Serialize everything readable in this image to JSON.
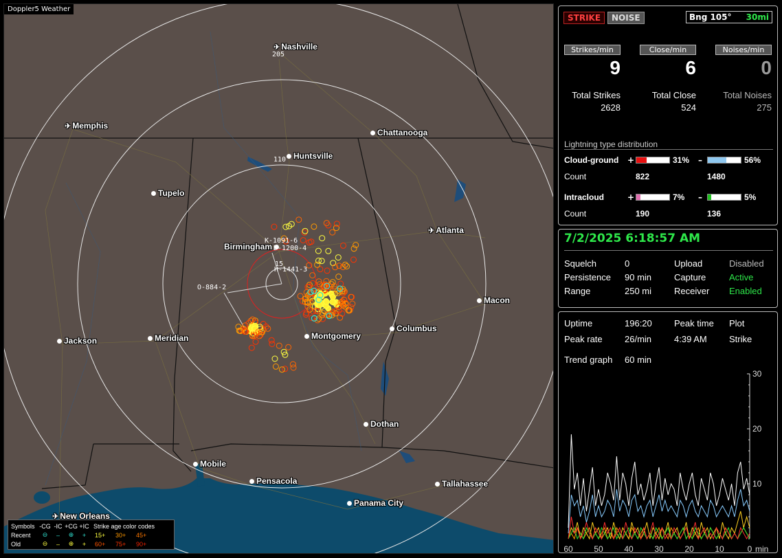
{
  "map": {
    "title": "Doppler5 Weather",
    "cities": [
      {
        "name": "Nashville",
        "icon": "plane-icon"
      },
      {
        "name": "Memphis",
        "icon": "plane-icon"
      },
      {
        "name": "Chattanooga",
        "icon": "dot-icon"
      },
      {
        "name": "Huntsville",
        "icon": "dot-icon"
      },
      {
        "name": "Tupelo",
        "icon": "dot-icon"
      },
      {
        "name": "Atlanta",
        "icon": "plane-icon"
      },
      {
        "name": "Birmingham",
        "icon": "dot-icon"
      },
      {
        "name": "Macon",
        "icon": "dot-icon"
      },
      {
        "name": "Jackson",
        "icon": "dot-icon"
      },
      {
        "name": "Meridian",
        "icon": "dot-icon"
      },
      {
        "name": "Montgomery",
        "icon": "dot-icon"
      },
      {
        "name": "Columbus",
        "icon": "dot-icon"
      },
      {
        "name": "Dothan",
        "icon": "dot-icon"
      },
      {
        "name": "Mobile",
        "icon": "dot-icon"
      },
      {
        "name": "Pensacola",
        "icon": "dot-icon"
      },
      {
        "name": "Tallahassee",
        "icon": "dot-icon"
      },
      {
        "name": "Panama City",
        "icon": "dot-icon"
      },
      {
        "name": "New Orleans",
        "icon": "plane-icon"
      }
    ],
    "ring_labels": [
      "205",
      "110",
      "15"
    ],
    "storm_labels": [
      "K-1091-6",
      "D-1200-4",
      "H-1441-3",
      "O-884-2"
    ],
    "legend": {
      "symbols_label": "Symbols",
      "headers": [
        "-CG",
        "-IC",
        "+CG",
        "+IC"
      ],
      "age_header": "Strike age color codes",
      "recent_label": "Recent",
      "old_label": "Old",
      "recent_ages": [
        "15+",
        "30+",
        "45+"
      ],
      "old_ages": [
        "60+",
        "75+",
        "90+"
      ],
      "age_colors": [
        "#ffff40",
        "#ff9900",
        "#ff6600",
        "#ff3300",
        "#dd2200",
        "#bb1100"
      ]
    }
  },
  "stats": {
    "strike_button": "STRIKE",
    "noise_button": "NOISE",
    "bearing_label": "Bng 105°",
    "range_label": "30mi",
    "strikes_per_min_label": "Strikes/min",
    "close_per_min_label": "Close/min",
    "noises_per_min_label": "Noises/min",
    "strikes_per_min": "9",
    "close_per_min": "6",
    "noises_per_min": "0",
    "total_strikes_label": "Total Strikes",
    "total_close_label": "Total Close",
    "total_noises_label": "Total Noises",
    "total_strikes": "2628",
    "total_close": "524",
    "total_noises": "275",
    "distribution_title": "Lightning type distribution",
    "cg_label": "Cloud-ground",
    "ic_label": "Intracloud",
    "count_label": "Count",
    "plus_sign": "+",
    "minus_sign": "–",
    "cg_pos_pct": "31%",
    "cg_neg_pct": "56%",
    "cg_pos_count": "822",
    "cg_neg_count": "1480",
    "ic_pos_pct": "7%",
    "ic_neg_pct": "5%",
    "ic_pos_count": "190",
    "ic_neg_count": "136",
    "cg_pos_frac": 0.31,
    "cg_neg_frac": 0.56,
    "ic_pos_frac": 0.07,
    "ic_neg_frac": 0.05,
    "colors": {
      "cg_pos": "#e81010",
      "cg_neg": "#8fc8f0",
      "ic_pos": "#e070b0",
      "ic_neg": "#20c020"
    }
  },
  "status": {
    "datetime": "7/2/2025 6:18:57 AM",
    "squelch_label": "Squelch",
    "squelch": "0",
    "persistence_label": "Persistence",
    "persistence": "90 min",
    "range_label": "Range",
    "range": "250 mi",
    "upload_label": "Upload",
    "upload": "Disabled",
    "capture_label": "Capture",
    "capture": "Active",
    "receiver_label": "Receiver",
    "receiver": "Enabled"
  },
  "trend": {
    "uptime_label": "Uptime",
    "uptime": "196:20",
    "peak_time_label": "Peak time",
    "peak_time": "4:39 AM",
    "plot_label": "Plot",
    "plot": "Strike",
    "peak_rate_label": "Peak rate",
    "peak_rate": "26/min",
    "trend_graph_label": "Trend graph",
    "trend_graph": "60 min"
  },
  "chart_data": {
    "type": "line",
    "x_ticks": [
      "60",
      "50",
      "40",
      "30",
      "20",
      "10",
      "0"
    ],
    "x_unit": "min",
    "y_ticks": [
      "30",
      "20",
      "10"
    ],
    "ylim": [
      0,
      30
    ],
    "xlim": [
      60,
      0
    ],
    "series": [
      {
        "color": "#ffffff",
        "values": [
          2,
          19,
          9,
          12,
          6,
          11,
          5,
          9,
          13,
          6,
          9,
          6,
          8,
          12,
          10,
          7,
          15,
          7,
          12,
          10,
          6,
          11,
          14,
          8,
          10,
          7,
          9,
          12,
          6,
          10,
          13,
          7,
          11,
          8,
          10,
          9,
          6,
          12,
          9,
          7,
          10,
          12,
          8,
          6,
          11,
          9,
          7,
          12,
          10,
          6,
          8,
          11,
          9,
          7,
          10,
          6,
          12,
          14,
          9,
          11,
          8
        ]
      },
      {
        "color": "#88ccff",
        "values": [
          1,
          8,
          6,
          7,
          4,
          6,
          3,
          5,
          8,
          4,
          6,
          4,
          5,
          7,
          6,
          4,
          9,
          5,
          7,
          6,
          4,
          7,
          8,
          5,
          6,
          4,
          6,
          7,
          4,
          6,
          8,
          5,
          7,
          5,
          6,
          5,
          4,
          7,
          6,
          4,
          6,
          7,
          5,
          4,
          6,
          5,
          4,
          7,
          6,
          4,
          5,
          6,
          5,
          4,
          6,
          4,
          7,
          9,
          6,
          7,
          5
        ]
      },
      {
        "color": "#ff3030",
        "values": [
          0,
          4,
          1,
          2,
          0,
          1,
          3,
          1,
          0,
          2,
          1,
          0,
          3,
          1,
          2,
          0,
          1,
          2,
          0,
          3,
          1,
          0,
          2,
          1,
          0,
          2,
          0,
          1,
          3,
          0,
          1,
          2,
          0,
          1,
          0,
          2,
          1,
          0,
          1,
          2,
          0,
          1,
          3,
          0,
          1,
          2,
          0,
          1,
          0,
          2,
          1,
          0,
          2,
          1,
          0,
          1,
          0,
          2,
          1,
          0,
          1
        ]
      },
      {
        "color": "#30e030",
        "values": [
          0,
          1,
          2,
          0,
          1,
          0,
          2,
          1,
          0,
          1,
          0,
          2,
          1,
          0,
          1,
          2,
          0,
          1,
          0,
          1,
          2,
          0,
          1,
          0,
          2,
          1,
          0,
          1,
          0,
          2,
          1,
          0,
          1,
          2,
          0,
          1,
          0,
          1,
          2,
          0,
          1,
          0,
          2,
          1,
          0,
          1,
          0,
          2,
          1,
          0,
          1,
          0,
          1,
          2,
          0,
          1,
          0,
          1,
          2,
          1,
          0
        ]
      },
      {
        "color": "#ffd020",
        "values": [
          0,
          2,
          1,
          3,
          0,
          2,
          1,
          0,
          3,
          1,
          2,
          0,
          1,
          2,
          0,
          3,
          1,
          0,
          2,
          1,
          0,
          3,
          1,
          2,
          0,
          1,
          3,
          0,
          2,
          1,
          0,
          2,
          1,
          3,
          0,
          1,
          2,
          0,
          1,
          3,
          0,
          2,
          1,
          0,
          3,
          1,
          2,
          0,
          1,
          2,
          0,
          3,
          1,
          0,
          2,
          1,
          3,
          5,
          2,
          4,
          2
        ]
      },
      {
        "color": "#ff9900",
        "values": [
          0,
          1,
          0,
          2,
          1,
          0,
          1,
          2,
          0,
          1,
          0,
          1,
          2,
          0,
          1,
          0,
          2,
          1,
          0,
          1,
          0,
          2,
          1,
          0,
          1,
          2,
          0,
          1,
          0,
          1,
          2,
          0,
          1,
          0,
          2,
          1,
          0,
          1,
          2,
          0,
          1,
          0,
          1,
          2,
          0,
          1,
          0,
          2,
          1,
          0,
          1,
          0,
          2,
          1,
          0,
          1,
          0,
          1,
          2,
          1,
          0
        ]
      }
    ]
  }
}
